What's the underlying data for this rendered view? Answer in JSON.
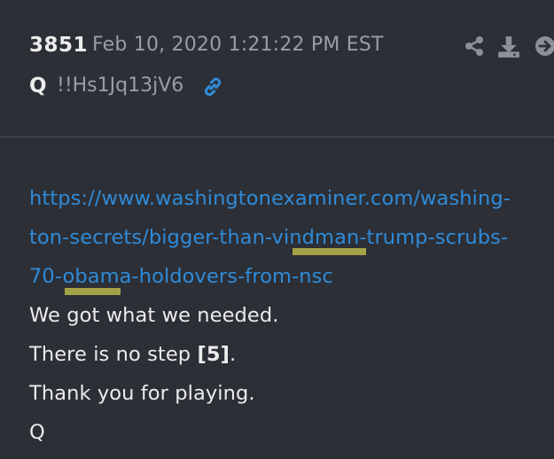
{
  "post": {
    "number": "3851",
    "date": "Feb 10, 2020 1:21:22 PM EST",
    "author": "Q",
    "tripcode": "!!Hs1Jq13jV6"
  },
  "icons": {
    "link": "link-icon",
    "share": "share-icon",
    "download": "download-icon",
    "next": "arrow-right-circle-icon"
  },
  "colors": {
    "background": "#2c2f36",
    "link": "#2f8bd8",
    "text": "#ececec",
    "meta": "#9a9da3",
    "highlight": "#b9b649"
  },
  "body": {
    "url_lines": [
      "https://www.washingtonexaminer.com/washing-",
      "ton-secrets/bigger-than-vindman-trump-scrubs-",
      "70-obama-holdovers-from-nsc"
    ],
    "line1": "We got what we needed.",
    "line2_prefix": "There is no step ",
    "line2_bold": "[5]",
    "line2_suffix": ".",
    "line3": "Thank you for playing.",
    "signature": "Q"
  }
}
